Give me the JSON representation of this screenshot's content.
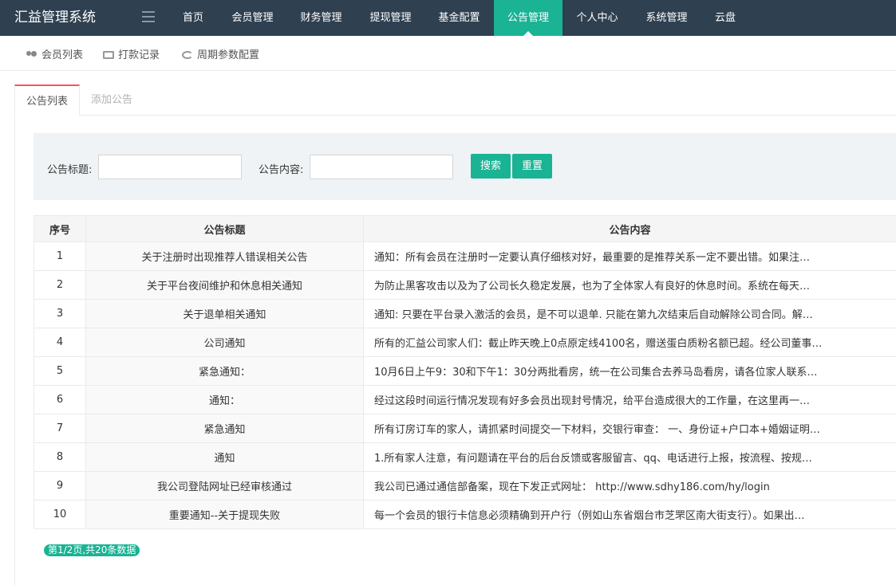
{
  "app": {
    "title": "汇益管理系统"
  },
  "nav": {
    "items": [
      {
        "label": "首页",
        "active": false
      },
      {
        "label": "会员管理",
        "active": false
      },
      {
        "label": "财务管理",
        "active": false
      },
      {
        "label": "提现管理",
        "active": false
      },
      {
        "label": "基金配置",
        "active": false
      },
      {
        "label": "公告管理",
        "active": true
      },
      {
        "label": "个人中心",
        "active": false
      },
      {
        "label": "系统管理",
        "active": false
      },
      {
        "label": "云盘",
        "active": false
      }
    ]
  },
  "subnav": {
    "items": [
      {
        "label": "会员列表",
        "icon": "users-icon"
      },
      {
        "label": "打款记录",
        "icon": "card-icon"
      },
      {
        "label": "周期参数配置",
        "icon": "refresh-icon"
      }
    ]
  },
  "tabs": [
    {
      "label": "公告列表",
      "active": true
    },
    {
      "label": "添加公告",
      "active": false
    }
  ],
  "search": {
    "title_label": "公告标题:",
    "title_value": "",
    "content_label": "公告内容:",
    "content_value": "",
    "search_button": "搜索",
    "reset_button": "重置"
  },
  "table": {
    "headers": [
      "序号",
      "公告标题",
      "公告内容"
    ],
    "rows": [
      {
        "no": "1",
        "title": "关于注册时出现推荐人错误相关公告",
        "content": "通知：所有会员在注册时一定要认真仔细核对好，最重要的是推荐关系一定不要出错。如果注…"
      },
      {
        "no": "2",
        "title": "关于平台夜间维护和休息相关通知",
        "content": "为防止黑客攻击以及为了公司长久稳定发展，也为了全体家人有良好的休息时间。系统在每天…"
      },
      {
        "no": "3",
        "title": "关于退单相关通知",
        "content": "通知: 只要在平台录入激活的会员，是不可以退单. 只能在第九次结束后自动解除公司合同。解…"
      },
      {
        "no": "4",
        "title": "公司通知",
        "content": "所有的汇益公司家人们：截止昨天晚上0点原定线4100名，赠送蛋白质粉名额已超。经公司董事…"
      },
      {
        "no": "5",
        "title": "紧急通知：",
        "content": "10月6日上午9：30和下午1：30分两批看房，统一在公司集合去养马岛看房，请各位家人联系…"
      },
      {
        "no": "6",
        "title": "通知：",
        "content": "经过这段时间运行情况发现有好多会员出现封号情况，给平台造成很大的工作量，在这里再一…"
      },
      {
        "no": "7",
        "title": "紧急通知",
        "content": "所有订房订车的家人，请抓紧时间提交一下材料，交银行审查： 一、身份证+户口本+婚姻证明…"
      },
      {
        "no": "8",
        "title": "通知",
        "content": "1.所有家人注意，有问题请在平台的后台反馈或客服留言、qq、电话进行上报，按流程、按规…"
      },
      {
        "no": "9",
        "title": "我公司登陆网址已经审核通过",
        "content": "我公司已通过通信部备案，现在下发正式网址： http://www.sdhy186.com/hy/login"
      },
      {
        "no": "10",
        "title": "重要通知--关于提现失败",
        "content": "每一个会员的银行卡信息必须精确到开户行（例如山东省烟台市芝罘区南大街支行）。如果出…"
      }
    ]
  },
  "pagination": {
    "text": "第1/2页,共20条数据"
  },
  "colors": {
    "nav_bg": "#2f4050",
    "accent": "#1ab394",
    "tab_active_border": "#ed5565"
  }
}
